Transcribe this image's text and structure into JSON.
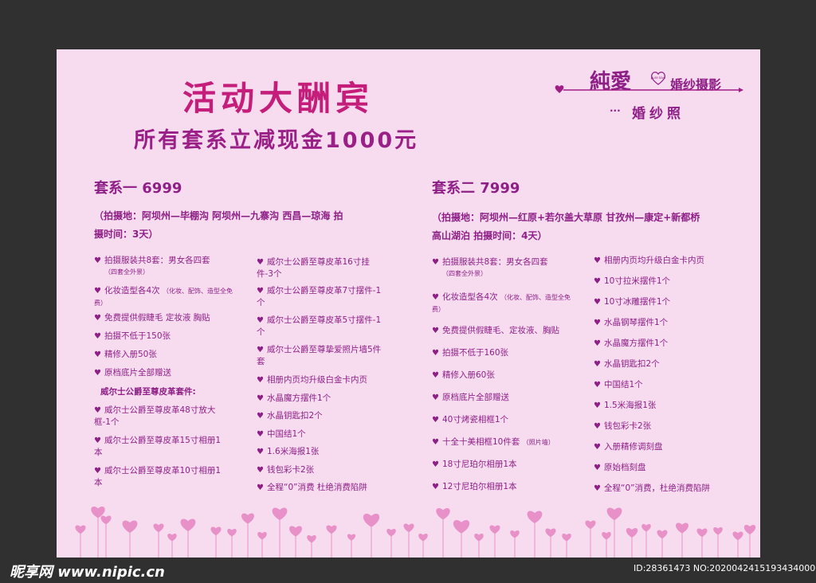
{
  "header": {
    "title": "活动大酬宾",
    "subtitle": "所有套系立减现金1000元"
  },
  "brand": {
    "name": "純愛",
    "type": "婚纱摄影",
    "tag": "婚纱照",
    "dots": "···",
    "logo_text": "pure love"
  },
  "packages": [
    {
      "title": "套系一 6999",
      "info_line1": "（拍摄地：阿坝州—毕棚沟  阿坝州—九寨沟  西昌—琼海     拍",
      "info_line2": "摄时间：3天）",
      "left_items": [
        {
          "text": "拍摄服装共8套：男女各四套",
          "note": "（四套全外景）"
        },
        {
          "text": "化妆造型各4次",
          "note": "（化妆、配饰、造型全免费）"
        },
        {
          "text": "免费提供假睫毛 定妆液 胸贴"
        },
        {
          "text": "拍摄不低于150张"
        },
        {
          "text": "精修入册50张"
        },
        {
          "text": "原档底片全部赠送"
        }
      ],
      "subhead": "威尔士公爵至尊皮革套件:",
      "left_items_2": [
        {
          "text": "威尔士公爵至尊皮革48寸放大框-1个"
        },
        {
          "text": "威尔士公爵至尊皮革15寸相册1本"
        },
        {
          "text": "威尔士公爵至尊皮革10寸相册1本"
        }
      ],
      "right_items": [
        "威尔士公爵至尊皮革16寸挂件-3个",
        "威尔士公爵至尊皮革7寸摆件-1个",
        "威尔士公爵至尊皮革5寸摆件-1个",
        "威尔士公爵至尊挚爱照片墙5件套",
        "相册内页均升级白金卡内页",
        "水晶魔方摆件1个",
        "水晶钥匙扣2个",
        "中国结1个",
        "1.6米海报1张",
        "钱包彩卡2张",
        "全程“0”消费 杜绝消费陷阱"
      ]
    },
    {
      "title": "套系二 7999",
      "info_line1": "（拍摄地：阿坝州—红原+若尔盖大草原  甘孜州—康定+新都桥",
      "info_line2": "高山湖泊    拍摄时间：4天）",
      "left_items": [
        {
          "text": "拍摄服装共8套：男女各四套",
          "note": "（四套全外景）"
        },
        {
          "text": "化妆造型各4次",
          "note": "（化妆、配饰、造型全免费）"
        },
        {
          "text": "免费提供假睫毛、定妆液、胸贴"
        },
        {
          "text": "拍摄不低于160张"
        },
        {
          "text": "精修入册60张"
        },
        {
          "text": "原档底片全部赠送"
        },
        {
          "text": "40寸烤瓷相框1个"
        },
        {
          "text": "十全十美相框10件套",
          "note": "（照片墙）"
        },
        {
          "text": "18寸尼珀尔相册1本"
        },
        {
          "text": "12寸尼珀尔相册1本"
        }
      ],
      "right_items": [
        "相册内页均升级白金卡内页",
        "10寸拉米摆件1个",
        "10寸冰雕摆件1个",
        "水晶钢琴摆件1个",
        "水晶魔方摆件1个",
        "水晶钥匙扣2个",
        "中国结1个",
        "1.5米海报1张",
        "钱包彩卡2张",
        "入册精修调刻盘",
        "原始档刻盘",
        "全程“0”消费，杜绝消费陷阱"
      ]
    }
  ],
  "footer": {
    "watermark": "昵享网 www.nipic.cn",
    "id_text": "ID:28361473 NO:20200424151934340000"
  },
  "colors": {
    "background": "#f7dcef",
    "title": "#c41e7a",
    "text": "#8e1f86",
    "hearts": "#e890c8"
  }
}
